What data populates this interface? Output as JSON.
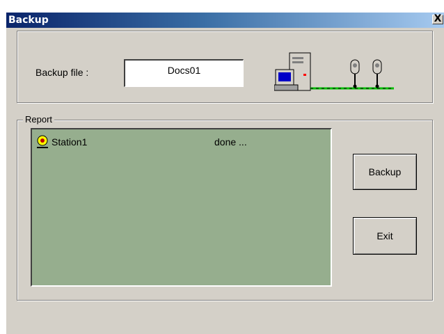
{
  "window": {
    "title": "Backup",
    "close_label": "X"
  },
  "backup_file": {
    "label": "Backup file  :",
    "value": "Docs01"
  },
  "report": {
    "legend": "Report",
    "items": [
      {
        "name": "Station1",
        "status": "done ..."
      }
    ]
  },
  "buttons": {
    "backup_label": "Backup",
    "exit_label": "Exit"
  },
  "icons": {
    "title_close": "close-icon",
    "network": "network-graphic-icon",
    "station": "station-icon"
  },
  "colors": {
    "list_background": "#96ae8e",
    "dialog_background": "#d4d0c8",
    "network_line": "#00c000",
    "title_bar": "#0a246a"
  }
}
